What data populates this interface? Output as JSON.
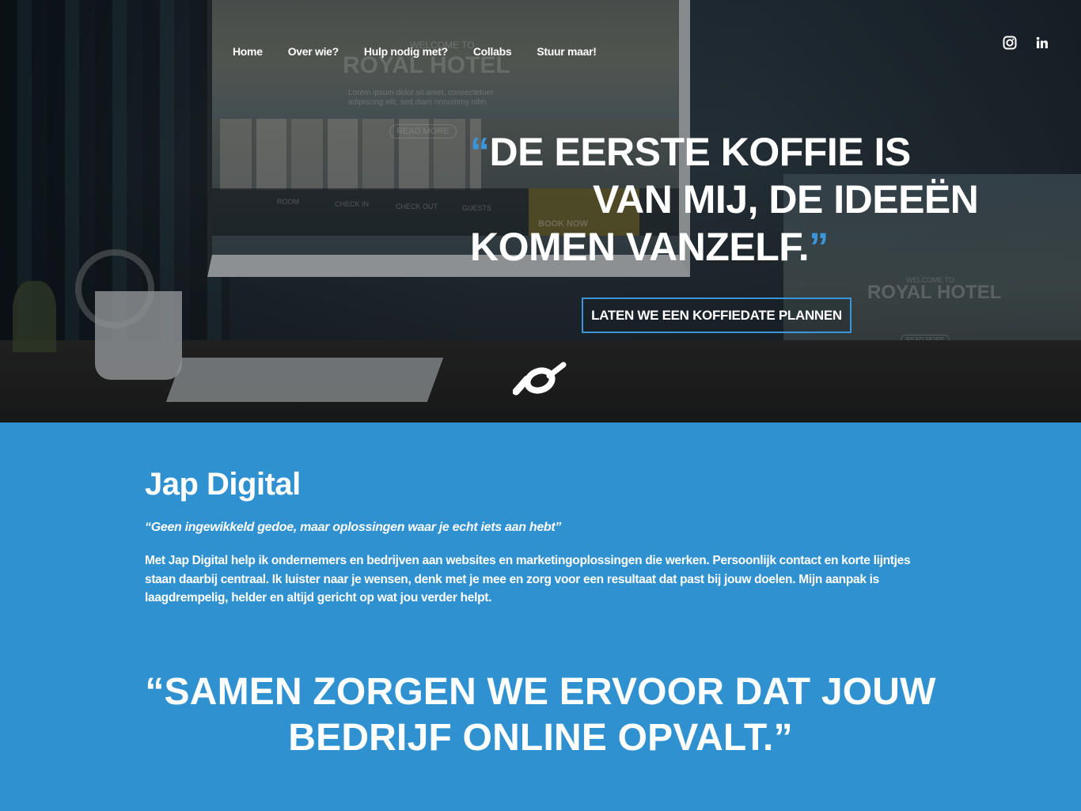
{
  "nav": {
    "items": [
      {
        "label": "Home"
      },
      {
        "label": "Over wie?"
      },
      {
        "label": "Hulp nodig met?"
      },
      {
        "label": "Collabs"
      },
      {
        "label": "Stuur maar!"
      }
    ],
    "social": [
      {
        "icon": "instagram-icon"
      },
      {
        "icon": "linkedin-icon"
      }
    ]
  },
  "hero": {
    "quote_open": "“",
    "quote_line1": "DE EERSTE KOFFIE IS",
    "quote_line2": "VAN MIJ, DE IDEEËN",
    "quote_line3": "KOMEN VANZELF.",
    "quote_close": "”",
    "cta_label": "LATEN WE EEN KOFFIEDATE PLANNEN",
    "accent_color": "#3a96d8",
    "logo_icon": "jap-digital-logo-icon",
    "background": {
      "monitor_text": {
        "welcome": "WELCOME TO",
        "hotel_name": "ROYAL HOTEL",
        "lorem": "Lorem ipsum dolor sit amet, consectetuer adipiscing elit, sed diam nonummy nibh",
        "read_more": "READ MORE",
        "room": "ROOM",
        "check_in": "CHECK IN",
        "check_out": "CHECK OUT",
        "guests": "GUESTS",
        "book_now": "BOOK NOW"
      }
    }
  },
  "about": {
    "title": "Jap Digital",
    "tagline": "“Geen ingewikkeld gedoe, maar oplossingen waar je echt iets aan hebt”",
    "body": "Met Jap Digital help ik ondernemers en bedrijven aan websites en marketingoplossingen die werken. Persoonlijk contact en korte lijntjes staan daarbij centraal. Ik luister naar je wensen, denk met je mee en zorg voor een resultaat dat past bij jouw doelen. Mijn aanpak is laagdrempelig, helder en altijd gericht op wat jou verder helpt.",
    "quote_line1": "“SAMEN ZORGEN WE ERVOOR DAT JOUW",
    "quote_line2": "BEDRIJF ONLINE OPVALT.”",
    "background_color": "#3091d1"
  }
}
